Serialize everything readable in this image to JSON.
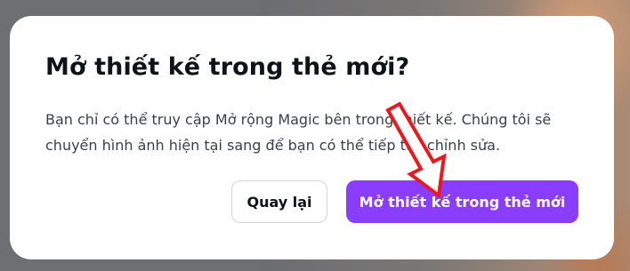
{
  "dialog": {
    "title": "Mở thiết kế trong thẻ mới?",
    "body": "Bạn chỉ có thể truy cập Mở rộng Magic bên trong thiết kế. Chúng tôi sẽ chuyển hình ảnh hiện tại sang để bạn có thể tiếp tục chỉnh sửa.",
    "back_label": "Quay lại",
    "open_label": "Mở thiết kế trong thẻ mới"
  },
  "colors": {
    "primary_button": "#8b3dff",
    "annotation_arrow": "#e8191f",
    "overlay": "#6e6f73"
  },
  "icons": {
    "annotation": "red-arrow-icon"
  }
}
